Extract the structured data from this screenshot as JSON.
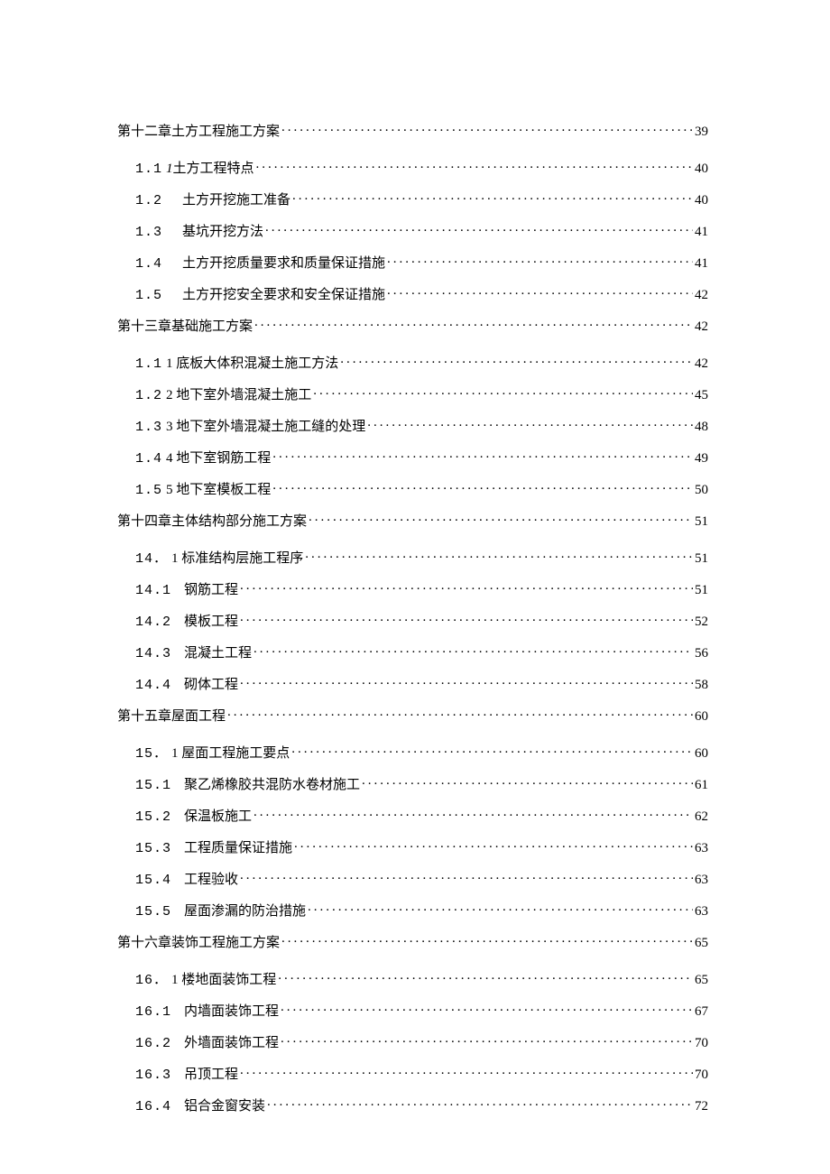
{
  "toc": [
    {
      "type": "chapter",
      "num": "",
      "title": "第十二章土方工程施工方案",
      "page": "39"
    },
    {
      "type": "sub",
      "first": true,
      "num": "1.1",
      "ital": "1",
      "gap": 4,
      "title": "土方工程特点",
      "page": "40"
    },
    {
      "type": "sub",
      "num": "1.2",
      "gap": 22,
      "title": "土方开挖施工准备",
      "page": "40"
    },
    {
      "type": "sub",
      "num": "1.3",
      "gap": 22,
      "title": "基坑开挖方法",
      "page": "41"
    },
    {
      "type": "sub",
      "num": "1.4",
      "gap": 22,
      "title": "土方开挖质量要求和质量保证措施",
      "page": "41"
    },
    {
      "type": "sub",
      "num": "1.5",
      "gap": 22,
      "title": "土方开挖安全要求和安全保证措施",
      "page": "42"
    },
    {
      "type": "chapter",
      "num": "",
      "title": "第十三章基础施工方案",
      "page": "42"
    },
    {
      "type": "sub",
      "first": true,
      "num": "1.1",
      "gap": 4,
      "title": "1 底板大体积混凝土施工方法",
      "page": "42"
    },
    {
      "type": "sub",
      "num": "1.2",
      "gap": 4,
      "title": "2 地下室外墙混凝土施工",
      "page": "45"
    },
    {
      "type": "sub",
      "num": "1.3",
      "gap": 4,
      "title": "3 地下室外墙混凝土施工缝的处理",
      "page": "48"
    },
    {
      "type": "sub",
      "num": "1.4",
      "gap": 4,
      "title": "4 地下室钢筋工程",
      "page": "49"
    },
    {
      "type": "sub",
      "num": "1.5",
      "gap": 4,
      "title": "5 地下室模板工程",
      "page": "50"
    },
    {
      "type": "chapter",
      "num": "",
      "title": "第十四章主体结构部分施工方案",
      "page": "51"
    },
    {
      "type": "sub",
      "first": true,
      "num": "14．",
      "gap": 4,
      "title": "1 标准结构层施工程序",
      "page": "51"
    },
    {
      "type": "sub",
      "num": "14.1",
      "gap": 14,
      "title": "钢筋工程",
      "page": "51"
    },
    {
      "type": "sub",
      "num": "14.2",
      "gap": 14,
      "title": "模板工程",
      "page": "52"
    },
    {
      "type": "sub",
      "num": "14.3",
      "gap": 14,
      "title": "混凝土工程",
      "page": "56"
    },
    {
      "type": "sub",
      "num": "14.4",
      "gap": 14,
      "title": "砌体工程",
      "page": "58"
    },
    {
      "type": "chapter",
      "num": "",
      "title": "第十五章屋面工程",
      "page": "60"
    },
    {
      "type": "sub",
      "first": true,
      "num": "15．",
      "gap": 4,
      "title": "1 屋面工程施工要点",
      "page": "60"
    },
    {
      "type": "sub",
      "num": "15.1",
      "gap": 14,
      "title": "聚乙烯橡胶共混防水卷材施工",
      "page": "61"
    },
    {
      "type": "sub",
      "num": "15.2",
      "gap": 14,
      "title": "保温板施工",
      "page": "62"
    },
    {
      "type": "sub",
      "num": "15.3",
      "gap": 14,
      "title": "工程质量保证措施",
      "page": "63"
    },
    {
      "type": "sub",
      "num": "15.4",
      "gap": 14,
      "title": "工程验收",
      "page": "63"
    },
    {
      "type": "sub",
      "num": "15.5",
      "gap": 14,
      "title": "屋面渗漏的防治措施",
      "page": "63"
    },
    {
      "type": "chapter",
      "num": "",
      "title": "第十六章装饰工程施工方案",
      "page": "65"
    },
    {
      "type": "sub",
      "first": true,
      "num": "16．",
      "gap": 4,
      "title": "1 楼地面装饰工程",
      "page": "65"
    },
    {
      "type": "sub",
      "num": "16.1",
      "gap": 14,
      "title": "内墙面装饰工程",
      "page": "67"
    },
    {
      "type": "sub",
      "num": "16.2",
      "gap": 14,
      "title": "外墙面装饰工程",
      "page": "70"
    },
    {
      "type": "sub",
      "num": "16.3",
      "gap": 14,
      "title": "吊顶工程",
      "page": "70"
    },
    {
      "type": "sub",
      "num": "16.4",
      "gap": 14,
      "title": "铝合金窗安装",
      "page": "72"
    }
  ]
}
